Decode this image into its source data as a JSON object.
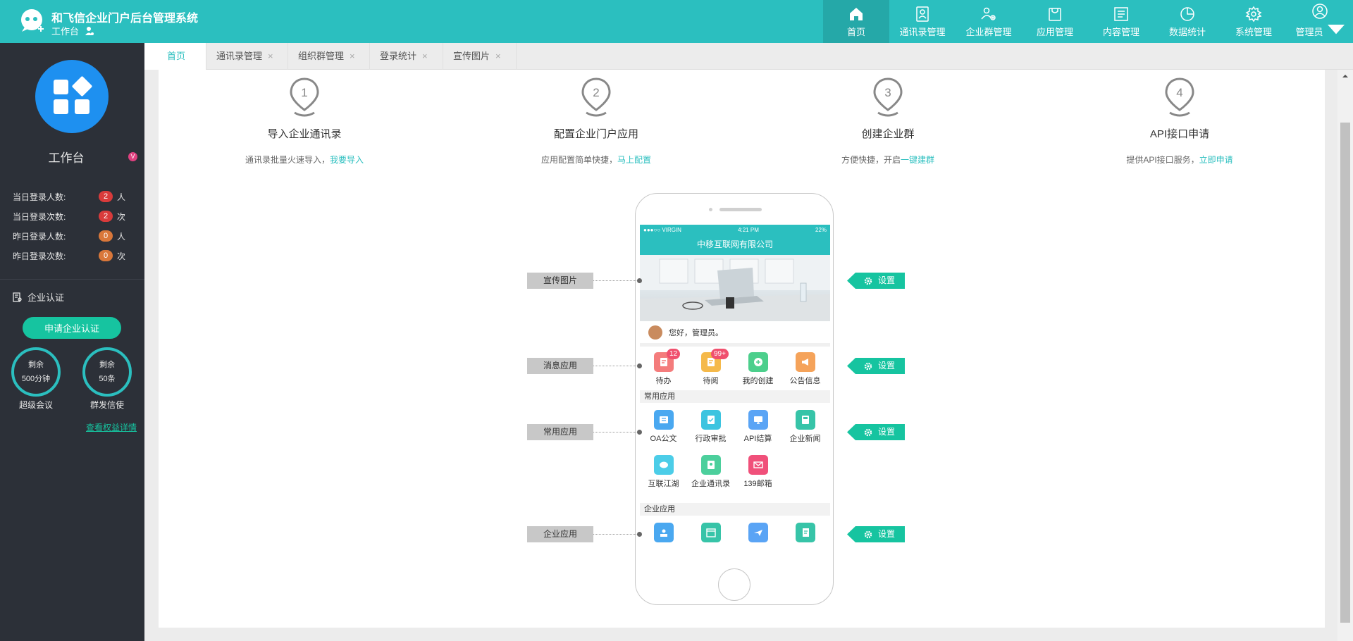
{
  "header": {
    "system_title": "和飞信企业门户后台管理系统",
    "workspace_label": "工作台",
    "nav": [
      {
        "label": "首页",
        "icon": "home-icon",
        "active": true
      },
      {
        "label": "通讯录管理",
        "icon": "contacts-icon"
      },
      {
        "label": "企业群管理",
        "icon": "group-settings-icon"
      },
      {
        "label": "应用管理",
        "icon": "app-bag-icon"
      },
      {
        "label": "内容管理",
        "icon": "content-icon"
      },
      {
        "label": "数据统计",
        "icon": "pie-chart-icon"
      },
      {
        "label": "系统管理",
        "icon": "gear-icon"
      },
      {
        "label": "管理员",
        "icon": "user-icon",
        "dropdown": true
      }
    ]
  },
  "sidebar": {
    "title": "工作台",
    "badge": "V",
    "stats": [
      {
        "label": "当日登录人数:",
        "value": "2",
        "unit": "人",
        "color": "#e04040"
      },
      {
        "label": "当日登录次数:",
        "value": "2",
        "unit": "次",
        "color": "#e04040"
      },
      {
        "label": "昨日登录人数:",
        "value": "0",
        "unit": "人",
        "color": "#e07a30"
      },
      {
        "label": "昨日登录次数:",
        "value": "0",
        "unit": "次",
        "color": "#e07a30"
      }
    ],
    "cert_label": "企业认证",
    "cert_button": "申请企业认证",
    "rings": [
      {
        "top": "剩余",
        "bottom": "500分钟",
        "caption": "超级会议"
      },
      {
        "top": "剩余",
        "bottom": "50条",
        "caption": "群发信使"
      }
    ],
    "rights_link": "查看权益详情"
  },
  "tabs": [
    {
      "label": "首页",
      "closable": false,
      "active": true
    },
    {
      "label": "通讯录管理",
      "closable": true
    },
    {
      "label": "组织群管理",
      "closable": true
    },
    {
      "label": "登录统计",
      "closable": true
    },
    {
      "label": "宣传图片",
      "closable": true
    }
  ],
  "steps": [
    {
      "num": "1",
      "title": "导入企业通讯录",
      "desc": "通讯录批量火速导入，",
      "link": "我要导入"
    },
    {
      "num": "2",
      "title": "配置企业门户应用",
      "desc": "应用配置简单快捷，",
      "link": "马上配置"
    },
    {
      "num": "3",
      "title": "创建企业群",
      "desc": "方便快捷，开启",
      "link": "一键建群"
    },
    {
      "num": "4",
      "title": "API接口申请",
      "desc": "提供API接口服务，",
      "link": "立即申请"
    }
  ],
  "phone": {
    "status_left": "●●●○○ VIRGIN",
    "status_time": "4:21 PM",
    "status_right": "22%",
    "company": "中移互联网有限公司",
    "greeting": "您好，管理员。",
    "message_apps": [
      {
        "label": "待办",
        "badge": "12",
        "color": "#f47c7c",
        "icon": "todo-icon"
      },
      {
        "label": "待阅",
        "badge": "99+",
        "color": "#f5b94a",
        "icon": "read-icon"
      },
      {
        "label": "我的创建",
        "color": "#4ccf8c",
        "icon": "create-icon"
      },
      {
        "label": "公告信息",
        "color": "#f5a35a",
        "icon": "announce-icon"
      }
    ],
    "common_header": "常用应用",
    "common_apps": [
      {
        "label": "OA公文",
        "color": "#4aa8f0",
        "icon": "oa-doc-icon"
      },
      {
        "label": "行政审批",
        "color": "#3cc4e0",
        "icon": "approval-icon"
      },
      {
        "label": "API结算",
        "color": "#5aa4f5",
        "icon": "api-monitor-icon"
      },
      {
        "label": "企业新闻",
        "color": "#37c4a8",
        "icon": "news-icon"
      },
      {
        "label": "互联江湖",
        "color": "#4ccde8",
        "icon": "chat-icon"
      },
      {
        "label": "企业通讯录",
        "color": "#4ccf9c",
        "icon": "address-book-icon"
      },
      {
        "label": "139邮箱",
        "color": "#f0507a",
        "icon": "mail-icon"
      }
    ],
    "enterprise_header": "企业应用",
    "enterprise_apps": [
      {
        "color": "#4aa8f0",
        "icon": "person-card-icon"
      },
      {
        "color": "#37c4a8",
        "icon": "calendar-icon"
      },
      {
        "color": "#5aa4f5",
        "icon": "plane-icon"
      },
      {
        "color": "#37c4a8",
        "icon": "document-icon"
      }
    ]
  },
  "sections": [
    {
      "label": "宣传图片",
      "button": "设置"
    },
    {
      "label": "消息应用",
      "button": "设置"
    },
    {
      "label": "常用应用",
      "button": "设置"
    },
    {
      "label": "企业应用",
      "button": "设置"
    }
  ]
}
